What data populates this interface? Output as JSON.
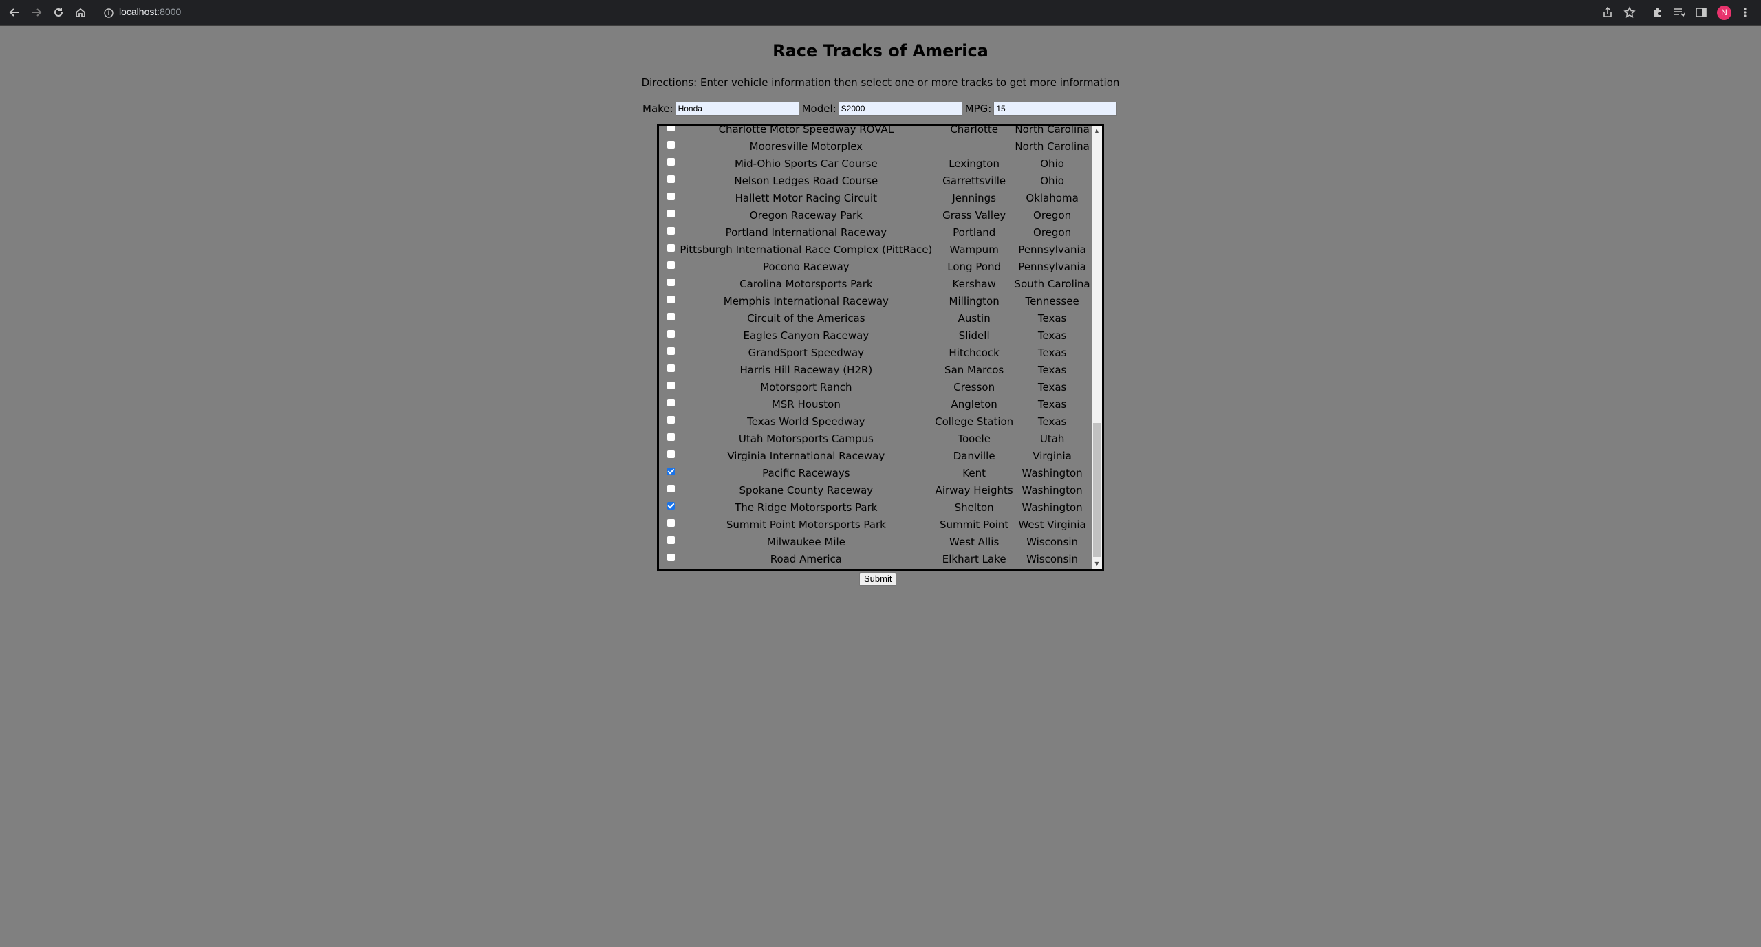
{
  "browser": {
    "url_host": "localhost",
    "url_port": ":8000",
    "avatar_letter": "N"
  },
  "page": {
    "title": "Race Tracks of America",
    "directions": "Directions: Enter vehicle information then select one or more tracks to get more information",
    "form": {
      "make_label": "Make:",
      "make_value": "Honda",
      "model_label": "Model:",
      "model_value": "S2000",
      "mpg_label": "MPG:",
      "mpg_value": "15"
    },
    "submit_label": "Submit"
  },
  "tracks": [
    {
      "checked": false,
      "name": "Charlotte Motor Speedway ROVAL",
      "city": "Charlotte",
      "state": "North Carolina"
    },
    {
      "checked": false,
      "name": "Mooresville Motorplex",
      "city": "",
      "state": "North Carolina"
    },
    {
      "checked": false,
      "name": "Mid-Ohio Sports Car Course",
      "city": "Lexington",
      "state": "Ohio"
    },
    {
      "checked": false,
      "name": "Nelson Ledges Road Course",
      "city": "Garrettsville",
      "state": "Ohio"
    },
    {
      "checked": false,
      "name": "Hallett Motor Racing Circuit",
      "city": "Jennings",
      "state": "Oklahoma"
    },
    {
      "checked": false,
      "name": "Oregon Raceway Park",
      "city": "Grass Valley",
      "state": "Oregon"
    },
    {
      "checked": false,
      "name": "Portland International Raceway",
      "city": "Portland",
      "state": "Oregon"
    },
    {
      "checked": false,
      "name": "Pittsburgh International Race Complex (PittRace)",
      "city": "Wampum",
      "state": "Pennsylvania"
    },
    {
      "checked": false,
      "name": "Pocono Raceway",
      "city": "Long Pond",
      "state": "Pennsylvania"
    },
    {
      "checked": false,
      "name": "Carolina Motorsports Park",
      "city": "Kershaw",
      "state": "South Carolina"
    },
    {
      "checked": false,
      "name": "Memphis International Raceway",
      "city": "Millington",
      "state": "Tennessee"
    },
    {
      "checked": false,
      "name": "Circuit of the Americas",
      "city": "Austin",
      "state": "Texas"
    },
    {
      "checked": false,
      "name": "Eagles Canyon Raceway",
      "city": "Slidell",
      "state": "Texas"
    },
    {
      "checked": false,
      "name": "GrandSport Speedway",
      "city": "Hitchcock",
      "state": "Texas"
    },
    {
      "checked": false,
      "name": "Harris Hill Raceway (H2R)",
      "city": "San Marcos",
      "state": "Texas"
    },
    {
      "checked": false,
      "name": "Motorsport Ranch",
      "city": "Cresson",
      "state": "Texas"
    },
    {
      "checked": false,
      "name": "MSR Houston",
      "city": "Angleton",
      "state": "Texas"
    },
    {
      "checked": false,
      "name": "Texas World Speedway",
      "city": "College Station",
      "state": "Texas"
    },
    {
      "checked": false,
      "name": "Utah Motorsports Campus",
      "city": "Tooele",
      "state": "Utah"
    },
    {
      "checked": false,
      "name": "Virginia International Raceway",
      "city": "Danville",
      "state": "Virginia"
    },
    {
      "checked": true,
      "name": "Pacific Raceways",
      "city": "Kent",
      "state": "Washington"
    },
    {
      "checked": false,
      "name": "Spokane County Raceway",
      "city": "Airway Heights",
      "state": "Washington"
    },
    {
      "checked": true,
      "name": "The Ridge Motorsports Park",
      "city": "Shelton",
      "state": "Washington"
    },
    {
      "checked": false,
      "name": "Summit Point Motorsports Park",
      "city": "Summit Point",
      "state": "West Virginia"
    },
    {
      "checked": false,
      "name": "Milwaukee Mile",
      "city": "West Allis",
      "state": "Wisconsin"
    },
    {
      "checked": false,
      "name": "Road America",
      "city": "Elkhart Lake",
      "state": "Wisconsin"
    }
  ]
}
